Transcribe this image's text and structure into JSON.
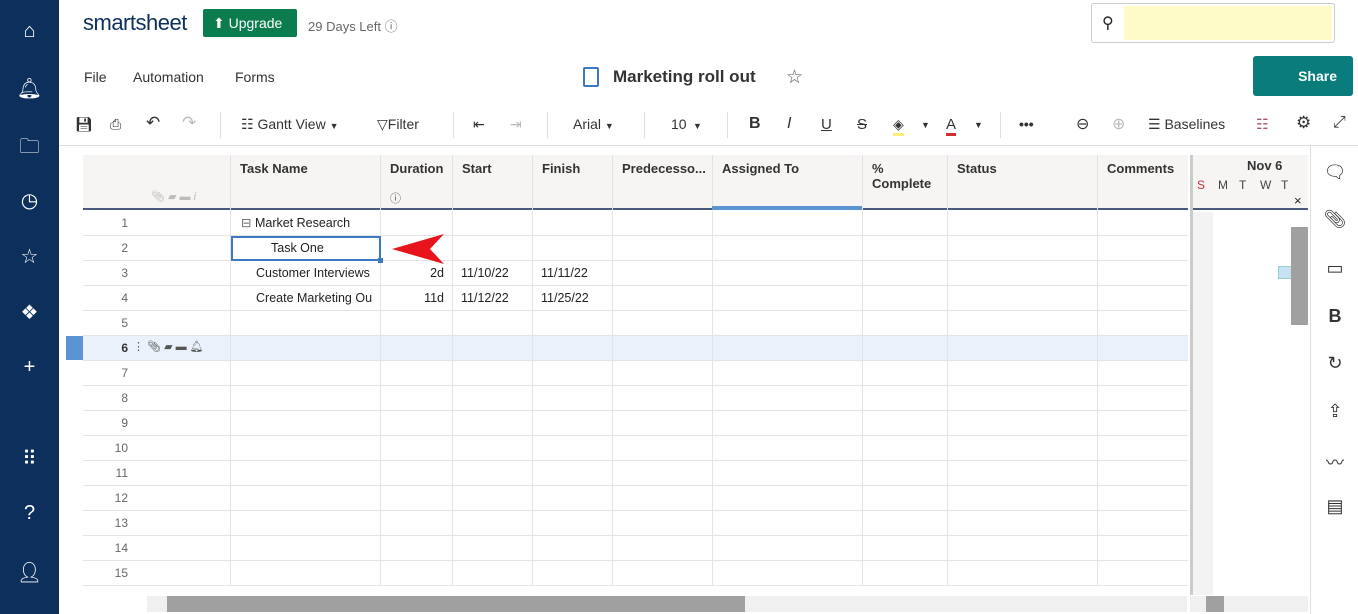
{
  "nav": {
    "icons": [
      "home-icon",
      "bell-icon",
      "folder-icon",
      "clock-icon",
      "star-icon",
      "solutions-icon",
      "plus-icon",
      "apps-grid-icon",
      "help-icon",
      "user-icon"
    ]
  },
  "header": {
    "logo": "smartsheet",
    "upgrade": "Upgrade",
    "days_left": "29 Days Left",
    "search_value": ""
  },
  "menu": {
    "file": "File",
    "automation": "Automation",
    "forms": "Forms"
  },
  "sheet": {
    "title": "Marketing roll out",
    "share": "Share"
  },
  "toolbar": {
    "view": "Gantt View",
    "filter": "Filter",
    "font": "Arial",
    "size": "10",
    "baselines": "Baselines",
    "more": "•••"
  },
  "columns": [
    "Task Name",
    "Duration",
    "Start",
    "Finish",
    "Predecesso...",
    "Assigned To",
    "% Complete",
    "Status",
    "Comments"
  ],
  "rows": [
    {
      "n": "1",
      "task": "Market Research",
      "duration": "",
      "start": "",
      "finish": "",
      "parent": true
    },
    {
      "n": "2",
      "task": "Task One",
      "duration": "",
      "start": "",
      "finish": "",
      "selected": true
    },
    {
      "n": "3",
      "task": "Customer Interviews",
      "duration": "2d",
      "start": "11/10/22",
      "finish": "11/11/22"
    },
    {
      "n": "4",
      "task": "Create Marketing Ou",
      "duration": "11d",
      "start": "11/12/22",
      "finish": "11/25/22"
    },
    {
      "n": "5"
    },
    {
      "n": "6",
      "active": true
    },
    {
      "n": "7"
    },
    {
      "n": "8"
    },
    {
      "n": "9"
    },
    {
      "n": "10"
    },
    {
      "n": "11"
    },
    {
      "n": "12"
    },
    {
      "n": "13"
    },
    {
      "n": "14"
    },
    {
      "n": "15"
    }
  ],
  "gantt": {
    "week": "Nov 6",
    "days": [
      "S",
      "M",
      "T",
      "W",
      "T"
    ]
  },
  "colors": {
    "nav": "#0d2f5b",
    "upgrade": "#0a7c4e",
    "share": "#0a7c7c",
    "selection": "#3d79c2",
    "arrow": "#e8141c"
  }
}
